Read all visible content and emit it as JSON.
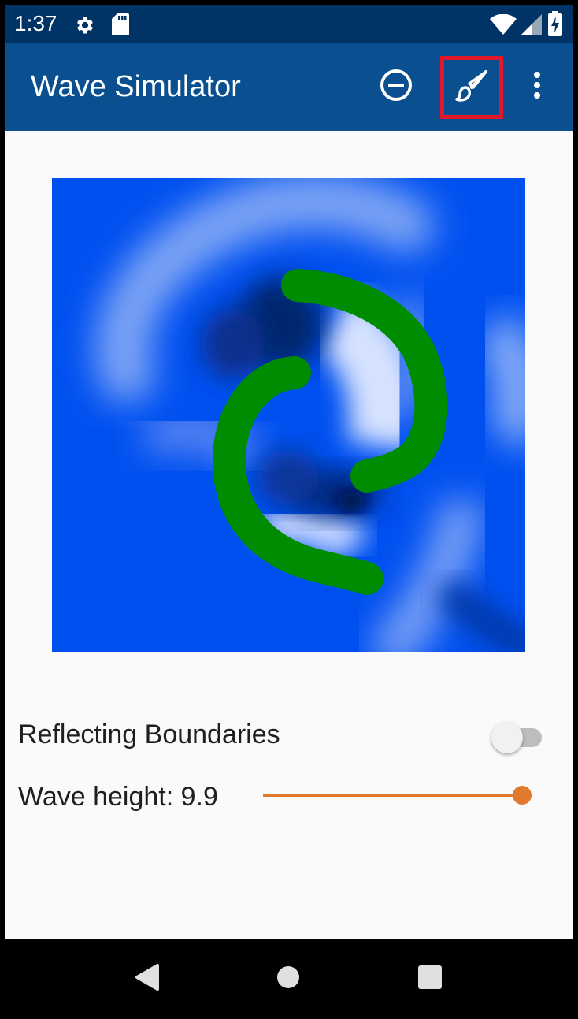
{
  "status_bar": {
    "time": "1:37",
    "icons": [
      "gear-icon",
      "sd-card-icon",
      "wifi-icon",
      "signal-icon",
      "battery-charging-icon"
    ]
  },
  "app_bar": {
    "title": "Wave Simulator",
    "actions": [
      "remove-circle-icon",
      "brush-icon",
      "more-vert-icon"
    ],
    "background": "#0a4f8f",
    "highlight_color": "#e0182a"
  },
  "simulation": {
    "wave_color": "#0050f0",
    "barrier_color": "#008c00"
  },
  "settings": {
    "reflecting_boundaries_label": "Reflecting Boundaries",
    "reflecting_boundaries_on": false,
    "wave_height_label": "Wave height: 9.9",
    "wave_height_fraction": 0.99,
    "accent_color": "#e07a2e"
  },
  "nav_bar": {
    "icons": [
      "back-icon",
      "home-icon",
      "recents-icon"
    ]
  }
}
